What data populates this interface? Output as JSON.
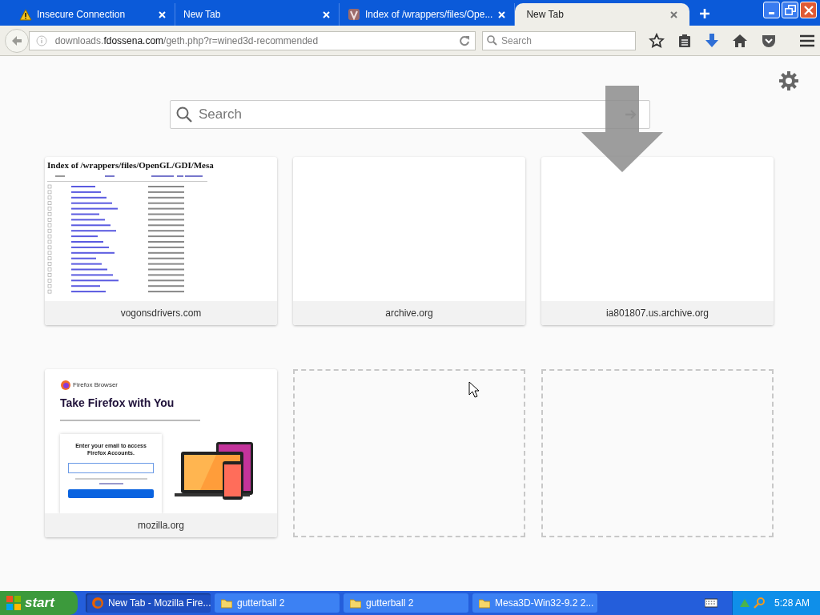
{
  "tabs": [
    {
      "title": "Insecure Connection",
      "kind": "warning",
      "selected": false
    },
    {
      "title": "New Tab",
      "kind": "plain",
      "selected": false
    },
    {
      "title": "Index of /wrappers/files/Ope...",
      "kind": "site",
      "selected": false
    },
    {
      "title": "New Tab",
      "kind": "plain",
      "selected": true
    }
  ],
  "address_bar": {
    "prefix": "downloads.",
    "domain": "fdossena.com",
    "path": "/geth.php?r=wined3d-recommended"
  },
  "toolbar_search": {
    "placeholder": "Search"
  },
  "page_search": {
    "placeholder": "Search"
  },
  "tiles": [
    {
      "kind": "index-page",
      "label": "vogonsdrivers.com",
      "heading": "Index of /wrappers/files/OpenGL/GDI/Mesa"
    },
    {
      "kind": "blank",
      "label": "archive.org"
    },
    {
      "kind": "blank",
      "label": "ia801807.us.archive.org"
    },
    {
      "kind": "firefox-page",
      "label": "mozilla.org",
      "brand": "Firefox Browser",
      "heading": "Take Firefox with You",
      "card_title": "Enter your email to access Firefox Accounts."
    },
    {
      "kind": "empty"
    },
    {
      "kind": "empty"
    }
  ],
  "taskbar": {
    "start": "start",
    "items": [
      {
        "label": "New Tab - Mozilla Fire...",
        "kind": "firefox",
        "selected": true
      },
      {
        "label": "gutterball 2",
        "kind": "folder",
        "selected": false
      },
      {
        "label": "gutterball 2",
        "kind": "folder",
        "selected": false
      },
      {
        "label": "Mesa3D-Win32-9.2 2...",
        "kind": "folder",
        "selected": false
      }
    ],
    "clock": "5:28 AM"
  }
}
